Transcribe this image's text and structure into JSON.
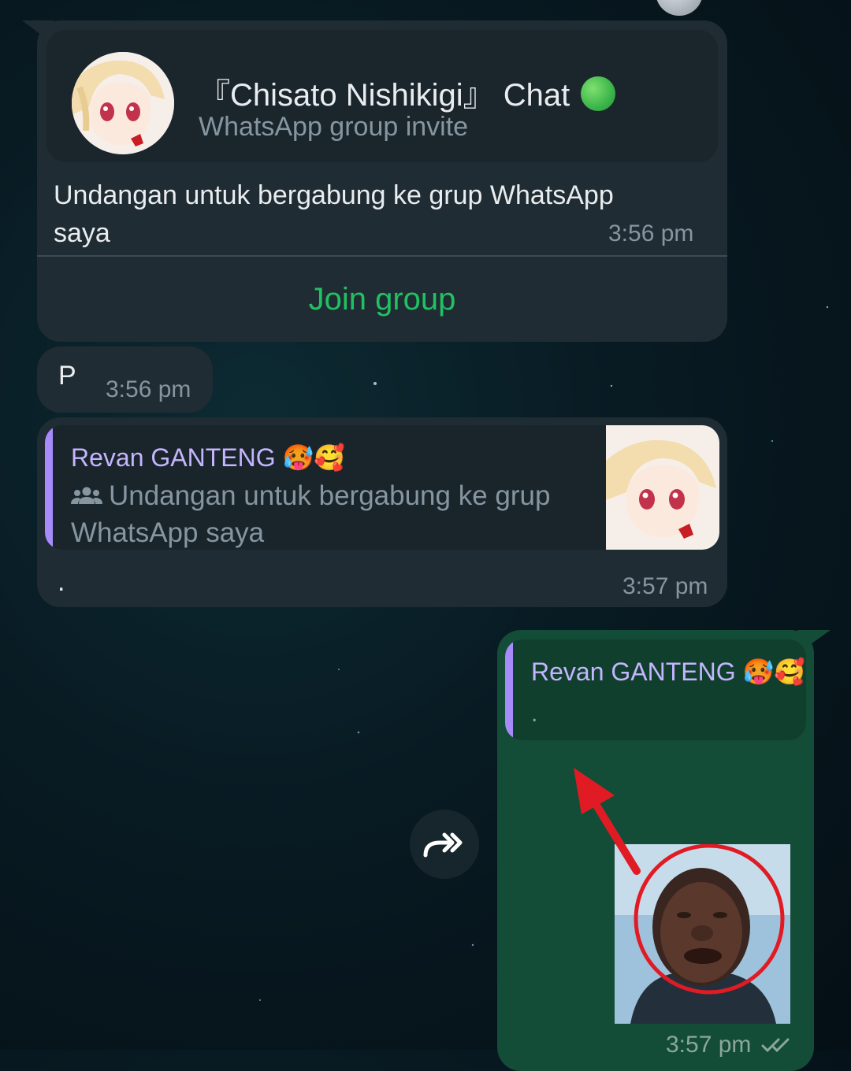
{
  "invite_message": {
    "group_name": "『Chisato Nishikigi』 Chat",
    "subtitle": "WhatsApp group invite",
    "text": "Undangan untuk bergabung ke grup WhatsApp saya",
    "time": "3:56 pm",
    "join_label": "Join group"
  },
  "p_message": {
    "text": "P",
    "time": "3:56 pm"
  },
  "reply_message": {
    "quoted_sender": "Revan GANTENG 🥵🥰",
    "quoted_text": "Undangan untuk bergabung ke grup WhatsApp saya",
    "text": ".",
    "time": "3:57 pm"
  },
  "outgoing_message": {
    "quoted_sender": "Revan GANTENG 🥵🥰",
    "quoted_text": ".",
    "time": "3:57 pm",
    "status_icon": "double-check-icon"
  },
  "forward_icon": "forward-icon",
  "colors": {
    "incoming_bubble": "#202c33",
    "outgoing_bubble": "#144d37",
    "join_green": "#21c063",
    "quote_accent": "#a78bfa",
    "annotation_red": "#e01b24"
  }
}
